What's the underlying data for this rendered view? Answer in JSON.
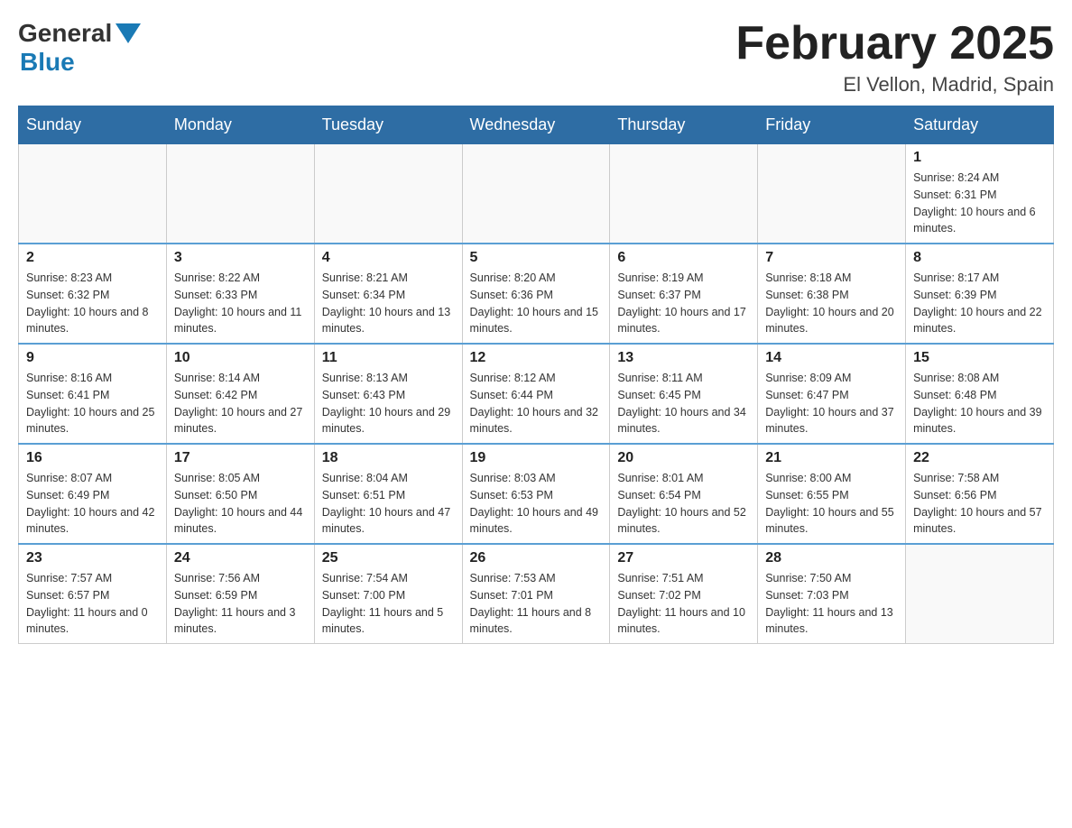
{
  "header": {
    "logo_general": "General",
    "logo_blue": "Blue",
    "title": "February 2025",
    "subtitle": "El Vellon, Madrid, Spain"
  },
  "weekdays": [
    "Sunday",
    "Monday",
    "Tuesday",
    "Wednesday",
    "Thursday",
    "Friday",
    "Saturday"
  ],
  "weeks": [
    [
      {
        "day": "",
        "info": ""
      },
      {
        "day": "",
        "info": ""
      },
      {
        "day": "",
        "info": ""
      },
      {
        "day": "",
        "info": ""
      },
      {
        "day": "",
        "info": ""
      },
      {
        "day": "",
        "info": ""
      },
      {
        "day": "1",
        "info": "Sunrise: 8:24 AM\nSunset: 6:31 PM\nDaylight: 10 hours and 6 minutes."
      }
    ],
    [
      {
        "day": "2",
        "info": "Sunrise: 8:23 AM\nSunset: 6:32 PM\nDaylight: 10 hours and 8 minutes."
      },
      {
        "day": "3",
        "info": "Sunrise: 8:22 AM\nSunset: 6:33 PM\nDaylight: 10 hours and 11 minutes."
      },
      {
        "day": "4",
        "info": "Sunrise: 8:21 AM\nSunset: 6:34 PM\nDaylight: 10 hours and 13 minutes."
      },
      {
        "day": "5",
        "info": "Sunrise: 8:20 AM\nSunset: 6:36 PM\nDaylight: 10 hours and 15 minutes."
      },
      {
        "day": "6",
        "info": "Sunrise: 8:19 AM\nSunset: 6:37 PM\nDaylight: 10 hours and 17 minutes."
      },
      {
        "day": "7",
        "info": "Sunrise: 8:18 AM\nSunset: 6:38 PM\nDaylight: 10 hours and 20 minutes."
      },
      {
        "day": "8",
        "info": "Sunrise: 8:17 AM\nSunset: 6:39 PM\nDaylight: 10 hours and 22 minutes."
      }
    ],
    [
      {
        "day": "9",
        "info": "Sunrise: 8:16 AM\nSunset: 6:41 PM\nDaylight: 10 hours and 25 minutes."
      },
      {
        "day": "10",
        "info": "Sunrise: 8:14 AM\nSunset: 6:42 PM\nDaylight: 10 hours and 27 minutes."
      },
      {
        "day": "11",
        "info": "Sunrise: 8:13 AM\nSunset: 6:43 PM\nDaylight: 10 hours and 29 minutes."
      },
      {
        "day": "12",
        "info": "Sunrise: 8:12 AM\nSunset: 6:44 PM\nDaylight: 10 hours and 32 minutes."
      },
      {
        "day": "13",
        "info": "Sunrise: 8:11 AM\nSunset: 6:45 PM\nDaylight: 10 hours and 34 minutes."
      },
      {
        "day": "14",
        "info": "Sunrise: 8:09 AM\nSunset: 6:47 PM\nDaylight: 10 hours and 37 minutes."
      },
      {
        "day": "15",
        "info": "Sunrise: 8:08 AM\nSunset: 6:48 PM\nDaylight: 10 hours and 39 minutes."
      }
    ],
    [
      {
        "day": "16",
        "info": "Sunrise: 8:07 AM\nSunset: 6:49 PM\nDaylight: 10 hours and 42 minutes."
      },
      {
        "day": "17",
        "info": "Sunrise: 8:05 AM\nSunset: 6:50 PM\nDaylight: 10 hours and 44 minutes."
      },
      {
        "day": "18",
        "info": "Sunrise: 8:04 AM\nSunset: 6:51 PM\nDaylight: 10 hours and 47 minutes."
      },
      {
        "day": "19",
        "info": "Sunrise: 8:03 AM\nSunset: 6:53 PM\nDaylight: 10 hours and 49 minutes."
      },
      {
        "day": "20",
        "info": "Sunrise: 8:01 AM\nSunset: 6:54 PM\nDaylight: 10 hours and 52 minutes."
      },
      {
        "day": "21",
        "info": "Sunrise: 8:00 AM\nSunset: 6:55 PM\nDaylight: 10 hours and 55 minutes."
      },
      {
        "day": "22",
        "info": "Sunrise: 7:58 AM\nSunset: 6:56 PM\nDaylight: 10 hours and 57 minutes."
      }
    ],
    [
      {
        "day": "23",
        "info": "Sunrise: 7:57 AM\nSunset: 6:57 PM\nDaylight: 11 hours and 0 minutes."
      },
      {
        "day": "24",
        "info": "Sunrise: 7:56 AM\nSunset: 6:59 PM\nDaylight: 11 hours and 3 minutes."
      },
      {
        "day": "25",
        "info": "Sunrise: 7:54 AM\nSunset: 7:00 PM\nDaylight: 11 hours and 5 minutes."
      },
      {
        "day": "26",
        "info": "Sunrise: 7:53 AM\nSunset: 7:01 PM\nDaylight: 11 hours and 8 minutes."
      },
      {
        "day": "27",
        "info": "Sunrise: 7:51 AM\nSunset: 7:02 PM\nDaylight: 11 hours and 10 minutes."
      },
      {
        "day": "28",
        "info": "Sunrise: 7:50 AM\nSunset: 7:03 PM\nDaylight: 11 hours and 13 minutes."
      },
      {
        "day": "",
        "info": ""
      }
    ]
  ]
}
